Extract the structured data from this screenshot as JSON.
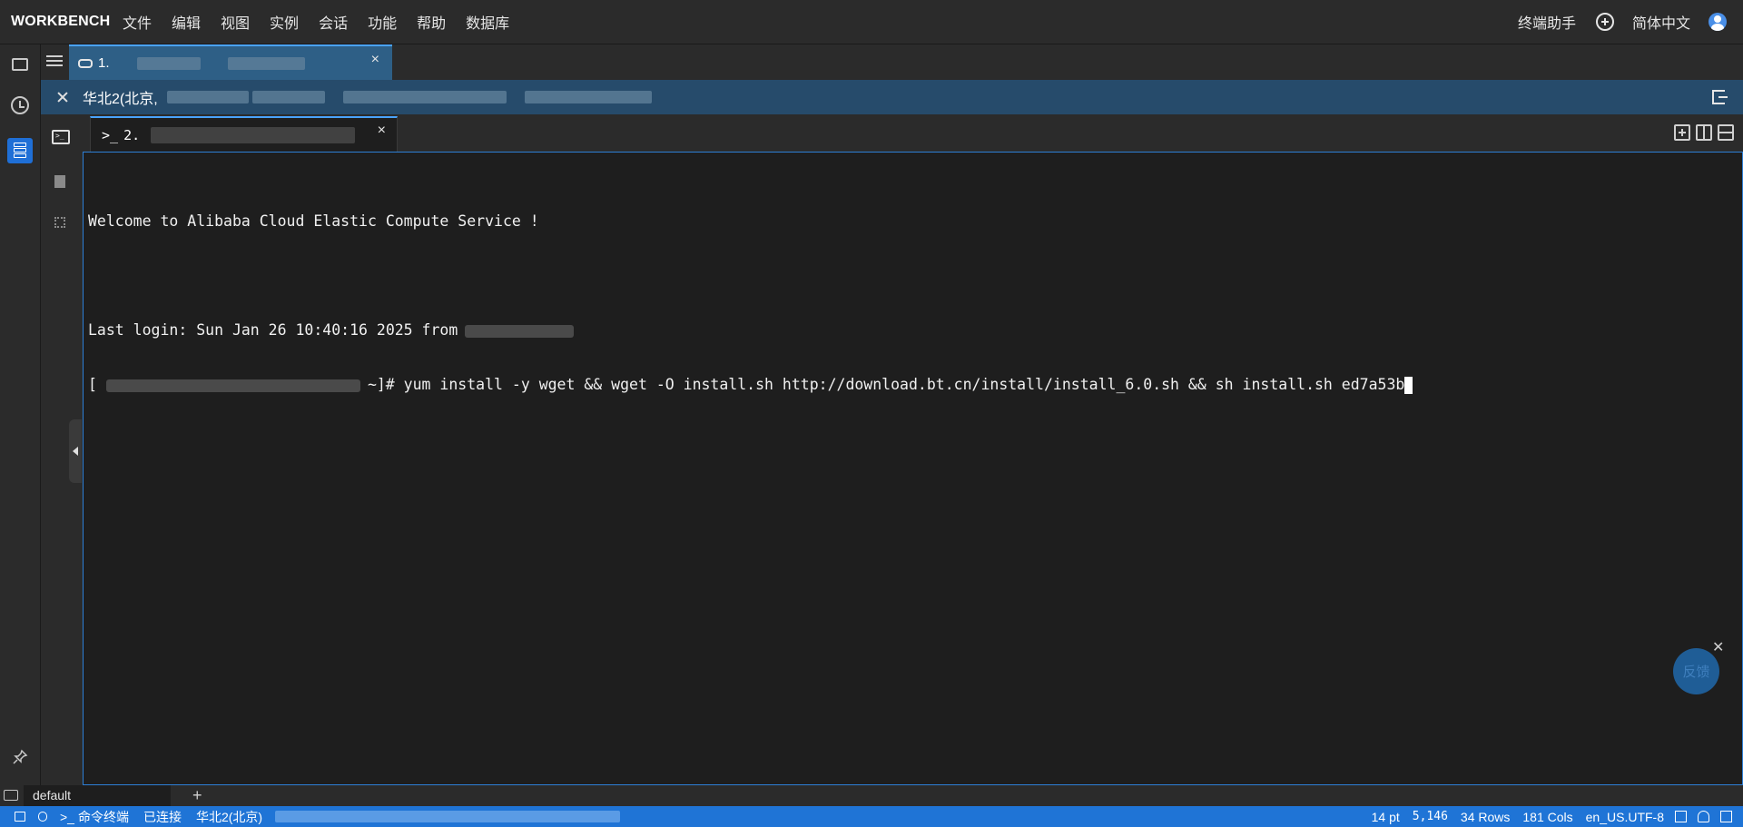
{
  "app": {
    "brand": "WORKBENCH"
  },
  "menu": [
    "文件",
    "编辑",
    "视图",
    "实例",
    "会话",
    "功能",
    "帮助",
    "数据库"
  ],
  "menubar_right": {
    "assistant": "终端助手",
    "language": "简体中文"
  },
  "session_tab": {
    "label": "1.",
    "close": "×"
  },
  "host_bar": {
    "region": "华北2(北京,"
  },
  "terminal_tab": {
    "prefix": ">_",
    "label": "2.",
    "close": "×"
  },
  "terminal": {
    "welcome": "Welcome to Alibaba Cloud Elastic Compute Service !",
    "last_login": "Last login: Sun Jan 26 10:40:16 2025 from",
    "prompt_open": "[",
    "prompt_close": "~]#",
    "command": " yum install -y wget && wget -O install.sh http://download.bt.cn/install/install_6.0.sh && sh install.sh ed7a53b"
  },
  "feedback": {
    "label": "反馈",
    "close": "✕"
  },
  "bottom_tabs": {
    "default": "default",
    "add": "+"
  },
  "status_bar": {
    "mode": "命令终端",
    "mode_prefix": ">_",
    "connection": "已连接",
    "region": "华北2(北京)",
    "font_size": "14 pt",
    "position": "5,146",
    "rows": "34 Rows",
    "cols": "181 Cols",
    "encoding": "en_US.UTF-8"
  },
  "colors": {
    "accent": "#1f74d6",
    "session_tab_bg": "#2e5f86",
    "host_bar_bg": "#264b6b",
    "terminal_bg": "#1e1e1e"
  },
  "icons": [
    "folder-icon",
    "history-icon",
    "server-list-icon",
    "pin-icon",
    "terminal-icon",
    "document-icon",
    "grid-icon",
    "list-icon",
    "link-icon",
    "expand-icon",
    "exit-icon",
    "add-pane-icon",
    "split-vertical-icon",
    "split-horizontal-icon",
    "add-circle-icon",
    "user-avatar-icon",
    "bell-icon"
  ]
}
